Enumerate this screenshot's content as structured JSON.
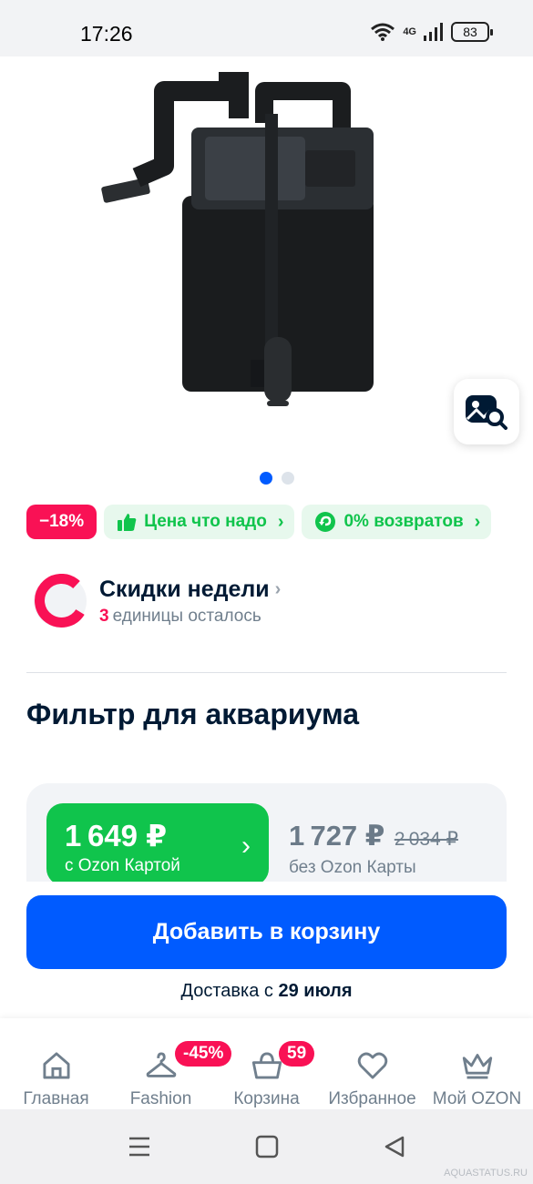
{
  "status_bar": {
    "time": "17:26",
    "network": "4G",
    "battery": "83"
  },
  "product_image": {
    "alt": "hang-on aquarium filter"
  },
  "carousel": {
    "total": 2,
    "active": 1
  },
  "badges": {
    "discount": "−18%",
    "price_label": "Цена что надо",
    "returns_label": "0% возвратов"
  },
  "promo": {
    "title": "Скидки недели",
    "count": "3",
    "remaining_text": "единицы осталось"
  },
  "product": {
    "title": "Фильтр для аквариума"
  },
  "price": {
    "card_price": "1 649 ₽",
    "card_label": "с Ozon Картой",
    "regular_price": "1 727 ₽",
    "old_price": "2 034 ₽",
    "regular_label": "без Ozon Карты"
  },
  "cart_button": {
    "label": "Добавить в корзину"
  },
  "delivery": {
    "prefix": "Доставка с",
    "date": "29 июля"
  },
  "bottom_nav": {
    "items": [
      {
        "label": "Главная",
        "icon": "home-icon"
      },
      {
        "label": "Fashion",
        "icon": "hanger-icon",
        "badge": "-45%"
      },
      {
        "label": "Корзина",
        "icon": "basket-icon",
        "badge": "59"
      },
      {
        "label": "Избранное",
        "icon": "heart-icon"
      },
      {
        "label": "Мой OZON",
        "icon": "crown-icon"
      }
    ]
  },
  "watermark": "AQUASTATUS.RU",
  "colors": {
    "accent": "#005bff",
    "green": "#10c44c",
    "pink": "#f91155"
  }
}
